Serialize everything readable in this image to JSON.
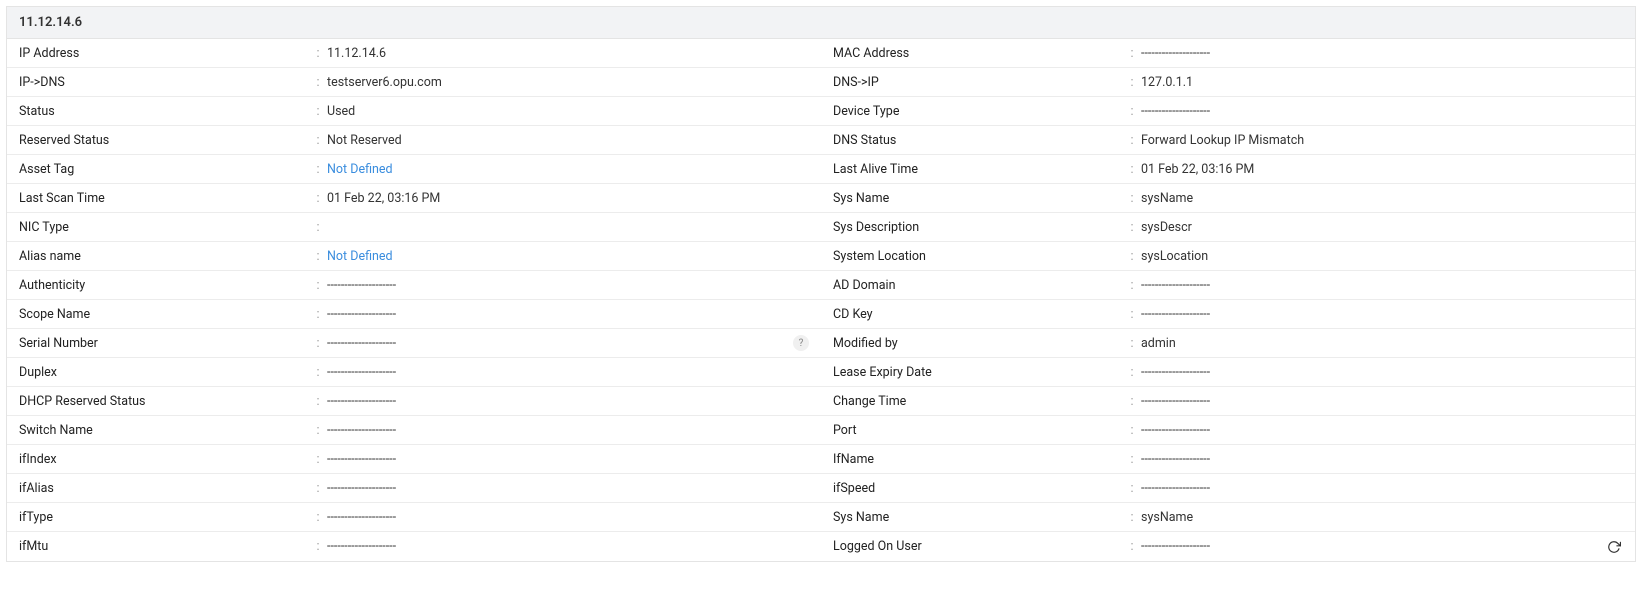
{
  "header": {
    "title": "11.12.14.6"
  },
  "placeholder": "--------------------",
  "rows": [
    {
      "left": {
        "label": "IP Address",
        "value": "11.12.14.6"
      },
      "right": {
        "label": "MAC Address",
        "value": "--------------------"
      }
    },
    {
      "left": {
        "label": "IP->DNS",
        "value": "testserver6.opu.com"
      },
      "right": {
        "label": "DNS->IP",
        "value": "127.0.1.1"
      }
    },
    {
      "left": {
        "label": "Status",
        "value": "Used"
      },
      "right": {
        "label": "Device Type",
        "value": "--------------------"
      }
    },
    {
      "left": {
        "label": "Reserved Status",
        "value": "Not Reserved"
      },
      "right": {
        "label": "DNS Status",
        "value": "Forward Lookup IP Mismatch"
      }
    },
    {
      "left": {
        "label": "Asset Tag",
        "value": "Not Defined",
        "link": true
      },
      "right": {
        "label": "Last Alive Time",
        "value": "01 Feb 22, 03:16 PM"
      }
    },
    {
      "left": {
        "label": "Last Scan Time",
        "value": "01 Feb 22, 03:16 PM"
      },
      "right": {
        "label": "Sys Name",
        "value": "sysName"
      }
    },
    {
      "left": {
        "label": "NIC Type",
        "value": ""
      },
      "right": {
        "label": "Sys Description",
        "value": "sysDescr"
      }
    },
    {
      "left": {
        "label": "Alias name",
        "value": "Not Defined",
        "link": true
      },
      "right": {
        "label": "System Location",
        "value": "sysLocation"
      }
    },
    {
      "left": {
        "label": "Authenticity",
        "value": "--------------------"
      },
      "right": {
        "label": "AD Domain",
        "value": "--------------------"
      }
    },
    {
      "left": {
        "label": "Scope Name",
        "value": "--------------------"
      },
      "right": {
        "label": "CD Key",
        "value": "--------------------"
      }
    },
    {
      "left": {
        "label": "Serial Number",
        "value": "--------------------",
        "info": true
      },
      "right": {
        "label": "Modified by",
        "value": "admin"
      }
    },
    {
      "left": {
        "label": "Duplex",
        "value": "--------------------"
      },
      "right": {
        "label": "Lease Expiry Date",
        "value": "--------------------"
      }
    },
    {
      "left": {
        "label": "DHCP Reserved Status",
        "value": "--------------------"
      },
      "right": {
        "label": "Change Time",
        "value": "--------------------"
      }
    },
    {
      "left": {
        "label": "Switch Name",
        "value": "--------------------"
      },
      "right": {
        "label": "Port",
        "value": "--------------------"
      }
    },
    {
      "left": {
        "label": "ifIndex",
        "value": "--------------------"
      },
      "right": {
        "label": "IfName",
        "value": "--------------------"
      }
    },
    {
      "left": {
        "label": "ifAlias",
        "value": "--------------------"
      },
      "right": {
        "label": "ifSpeed",
        "value": "--------------------"
      }
    },
    {
      "left": {
        "label": "ifType",
        "value": "--------------------"
      },
      "right": {
        "label": "Sys Name",
        "value": "sysName"
      }
    },
    {
      "left": {
        "label": "ifMtu",
        "value": "--------------------"
      },
      "right": {
        "label": "Logged On User",
        "value": "--------------------",
        "refresh": true
      }
    }
  ]
}
